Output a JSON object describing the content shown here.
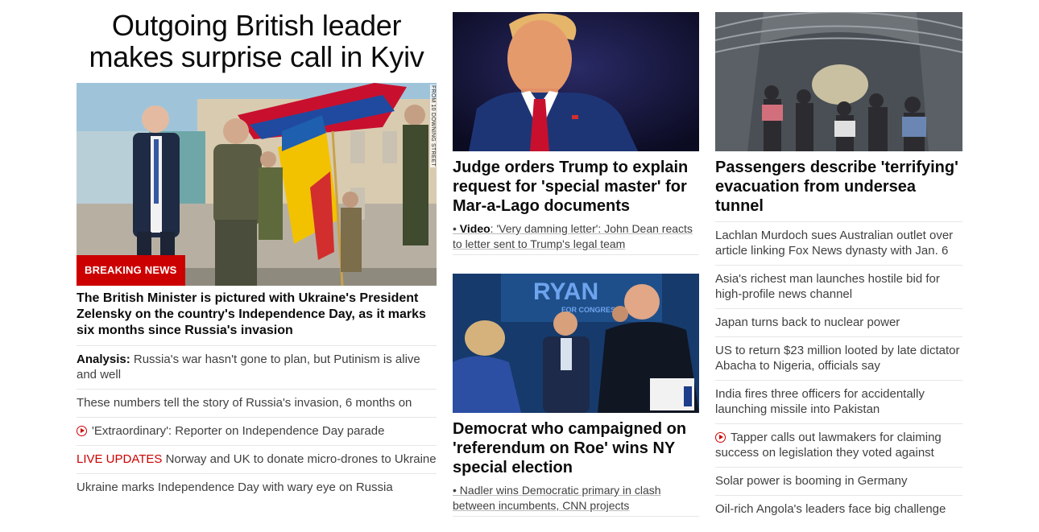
{
  "lead": {
    "title": "Outgoing British leader makes surprise call in Kyiv",
    "badge": "BREAKING NEWS",
    "image_credit": "FROM 10 DOWNING STREET",
    "caption": "The British Minister is pictured with Ukraine's President Zelensky on the country's Independence Day, as it marks six months since Russia's invasion",
    "related": [
      {
        "prefix": "Analysis:",
        "text": " Russia's war hasn't gone to plan, but Putinism is alive and well"
      },
      {
        "text": "These numbers tell the story of Russia's invasion, 6 months on"
      },
      {
        "video": true,
        "text": "'Extraordinary': Reporter on Independence Day parade"
      },
      {
        "live": "LIVE UPDATES",
        "text": " Norway and UK to donate micro-drones to Ukraine"
      },
      {
        "text": "Ukraine marks Independence Day with wary eye on Russia"
      }
    ]
  },
  "middle": {
    "story1": {
      "title": "Judge orders Trump to explain request for 'special master' for Mar-a-Lago documents",
      "sub_bullet": "• ",
      "sub_prefix": "Video",
      "sub_text": ": 'Very damning letter': John Dean reacts to letter sent to Trump's legal team"
    },
    "story2": {
      "sign_text": "RYAN",
      "sign_subtext": "FOR CONGRESS",
      "title": "Democrat who campaigned on 'referendum on Roe' wins NY special election",
      "sub_text": "• Nadler wins Democratic primary in clash between incumbents, CNN projects"
    }
  },
  "right": {
    "story": {
      "title": "Passengers describe 'terrifying' evacuation from undersea tunnel"
    },
    "headlines": [
      {
        "text": "Lachlan Murdoch sues Australian outlet over article linking Fox News dynasty with Jan. 6"
      },
      {
        "text": "Asia's richest man launches hostile bid for high-profile news channel"
      },
      {
        "text": "Japan turns back to nuclear power"
      },
      {
        "text": "US to return $23 million looted by late dictator Abacha to Nigeria, officials say"
      },
      {
        "text": "India fires three officers for accidentally launching missile into Pakistan"
      },
      {
        "video": true,
        "text": "Tapper calls out lawmakers for claiming success on legislation they voted against"
      },
      {
        "text": "Solar power is booming in Germany"
      },
      {
        "text": "Oil-rich Angola's leaders face big challenge"
      }
    ]
  },
  "colors": {
    "accent": "#cc0000",
    "text": "#0c0c0c",
    "muted": "#404040",
    "divider": "#e6e6e6"
  },
  "icons": {
    "video": "play-circle-icon"
  }
}
